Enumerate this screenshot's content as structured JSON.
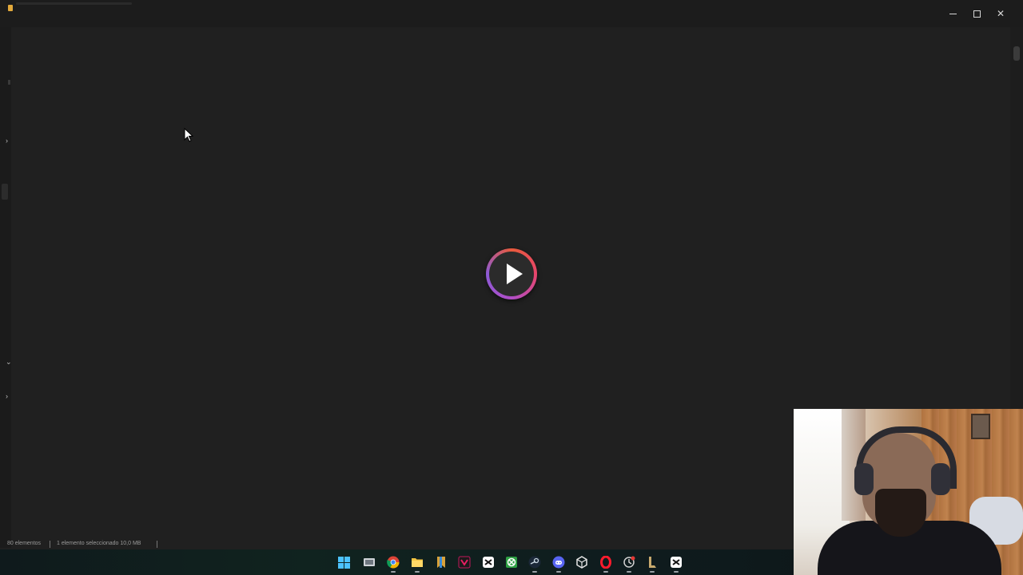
{
  "window": {
    "controls": {
      "minimize_icon": "minimize-icon",
      "maximize_icon": "restore-icon",
      "close_glyph": "✕"
    }
  },
  "sidebar": {
    "chevrons": [
      "›",
      "⌄",
      "›"
    ]
  },
  "media": {
    "play_icon": "play-icon",
    "ring_colors": [
      "#e95a3c",
      "#e7456b",
      "#b14ec8",
      "#8b5ad6"
    ]
  },
  "status_bar": {
    "items_count": "80 elementos",
    "selection": "1 elemento seleccionado 10,0 MB"
  },
  "taskbar": {
    "icons": [
      "windows-start-icon",
      "task-view-icon",
      "chrome-icon",
      "file-explorer-icon",
      "bookmark-app-icon",
      "vegas-app-icon",
      "capcut-icon",
      "xbox-icon",
      "steam-icon",
      "discord-icon",
      "unity-icon",
      "opera-gx-icon",
      "clock-app-icon",
      "league-launcher-icon",
      "capcut-secondary-icon"
    ],
    "discord_badge": "9+"
  },
  "webcam": {
    "label": "webcam-overlay"
  }
}
